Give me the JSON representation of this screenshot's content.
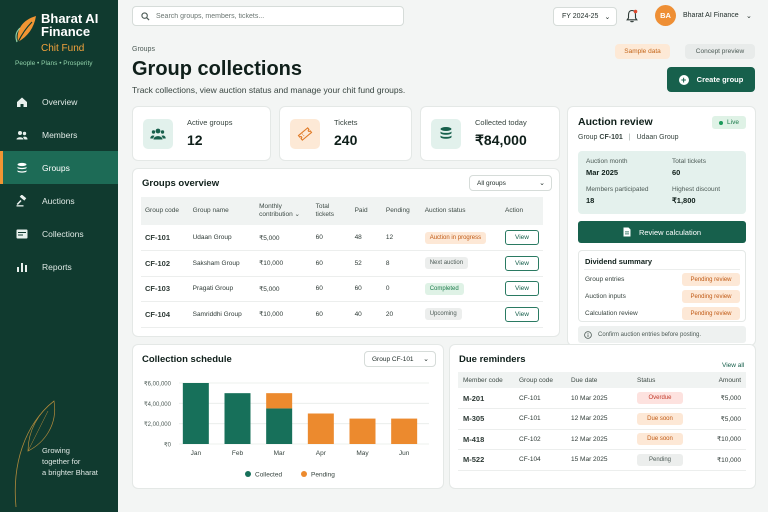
{
  "brand": {
    "title": "Bharat AI Finance",
    "subtitle": "Chit Fund",
    "tagline": "People • Plans • Prosperity",
    "footer_line1": "Growing",
    "footer_line2": "together for",
    "footer_line3": "a brighter Bharat"
  },
  "nav": [
    {
      "label": "Overview",
      "icon": "home-icon"
    },
    {
      "label": "Members",
      "icon": "members-icon"
    },
    {
      "label": "Groups",
      "icon": "groups-icon"
    },
    {
      "label": "Auctions",
      "icon": "gavel-icon"
    },
    {
      "label": "Collections",
      "icon": "collections-icon"
    },
    {
      "label": "Reports",
      "icon": "reports-icon"
    }
  ],
  "topbar": {
    "search_placeholder": "Search groups, members, tickets...",
    "fiscal_year": "FY 2024-25",
    "avatar_initials": "BA",
    "user_name": "Bharat AI Finance"
  },
  "header": {
    "breadcrumb": "Groups",
    "title": "Group collections",
    "subtitle": "Track collections, view auction status and manage your chit fund groups.",
    "sample_label": "Sample data",
    "concept_label": "Concept preview",
    "create_label": "Create group"
  },
  "stats": [
    {
      "label": "Active groups",
      "value": "12",
      "icon": "people-icon",
      "bg": "#e2f1ec",
      "fg": "#17604c"
    },
    {
      "label": "Tickets",
      "value": "240",
      "icon": "ticket-icon",
      "bg": "#fde9d6",
      "fg": "#e07a26"
    },
    {
      "label": "Collected today",
      "value": "₹84,000",
      "icon": "cash-stack-icon",
      "bg": "#e2f1ec",
      "fg": "#17604c"
    }
  ],
  "groups_overview": {
    "title": "Groups overview",
    "filter": "All groups",
    "headers": [
      "Group code",
      "Group name",
      "Monthly contribution",
      "Total tickets",
      "Paid",
      "Pending",
      "Auction status",
      "Action"
    ],
    "rows": [
      {
        "code": "CF-101",
        "name": "Udaan Group",
        "monthly": "₹5,000",
        "tickets": "60",
        "paid": "48",
        "pending": "12",
        "status": "Auction in progress",
        "status_kind": "progress",
        "action": "View"
      },
      {
        "code": "CF-102",
        "name": "Saksham Group",
        "monthly": "₹10,000",
        "tickets": "60",
        "paid": "52",
        "pending": "8",
        "status": "Next auction",
        "status_kind": "next",
        "action": "View"
      },
      {
        "code": "CF-103",
        "name": "Pragati Group",
        "monthly": "₹5,000",
        "tickets": "60",
        "paid": "60",
        "pending": "0",
        "status": "Completed",
        "status_kind": "completed",
        "action": "View"
      },
      {
        "code": "CF-104",
        "name": "Samriddhi Group",
        "monthly": "₹10,000",
        "tickets": "60",
        "paid": "40",
        "pending": "20",
        "status": "Upcoming",
        "status_kind": "upcoming",
        "action": "View"
      }
    ]
  },
  "auction_review": {
    "title": "Auction review",
    "live_label": "Live",
    "group_prefix": "Group",
    "group_code": "CF-101",
    "separator": "|",
    "group_name": "Udaan Group",
    "month_label": "Auction month",
    "month_value": "Mar 2025",
    "tickets_label": "Total tickets",
    "tickets_value": "60",
    "members_label": "Members participated",
    "members_value": "18",
    "discount_label": "Highest discount",
    "discount_value": "₹1,800",
    "review_button": "Review calculation",
    "dividend_title": "Dividend summary",
    "dividend_rows": [
      {
        "label": "Group entries",
        "status": "Pending review"
      },
      {
        "label": "Auction inputs",
        "status": "Pending review"
      },
      {
        "label": "Calculation review",
        "status": "Pending review"
      }
    ],
    "note": "Confirm auction entries before posting."
  },
  "collection_schedule": {
    "title": "Collection schedule",
    "filter": "Group CF-101",
    "legend_collected": "Collected",
    "legend_pending": "Pending"
  },
  "chart_data": {
    "type": "bar",
    "stacked": true,
    "categories": [
      "Jan",
      "Feb",
      "Mar",
      "Apr",
      "May",
      "Jun"
    ],
    "series": [
      {
        "name": "Collected",
        "color": "#17705a",
        "values": [
          600000,
          500000,
          350000,
          0,
          0,
          0
        ]
      },
      {
        "name": "Pending",
        "color": "#ec8a2e",
        "values": [
          0,
          0,
          150000,
          300000,
          250000,
          250000
        ]
      }
    ],
    "y_ticks": [
      "₹0",
      "₹2,00,000",
      "₹4,00,000",
      "₹6,00,000"
    ],
    "ylim": [
      0,
      600000
    ],
    "grid": true,
    "legend": "bottom"
  },
  "reminders": {
    "title": "Due reminders",
    "view_all": "View all",
    "headers": [
      "Member code",
      "Group code",
      "Due date",
      "Status",
      "Amount"
    ],
    "rows": [
      {
        "member": "M-201",
        "group": "CF-101",
        "date": "10 Mar 2025",
        "status": "Overdue",
        "kind": "overdue",
        "amount": "₹5,000"
      },
      {
        "member": "M-305",
        "group": "CF-101",
        "date": "12 Mar 2025",
        "status": "Due soon",
        "kind": "soon",
        "amount": "₹5,000"
      },
      {
        "member": "M-418",
        "group": "CF-102",
        "date": "12 Mar 2025",
        "status": "Due soon",
        "kind": "soon",
        "amount": "₹10,000"
      },
      {
        "member": "M-522",
        "group": "CF-104",
        "date": "15 Mar 2025",
        "status": "Pending",
        "kind": "pending",
        "amount": "₹10,000"
      }
    ]
  }
}
